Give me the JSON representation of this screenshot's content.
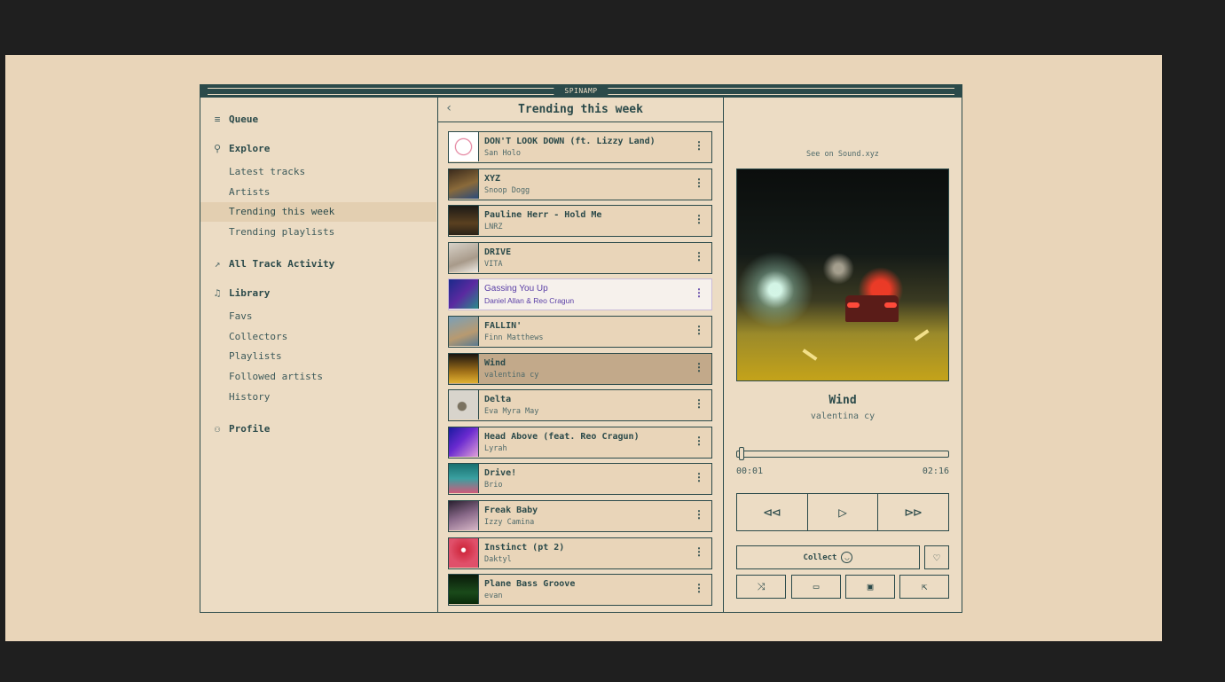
{
  "app": {
    "title": "SPINAMP"
  },
  "colors": {
    "ink": "#2b4a4a",
    "paper": "#ecdcc4",
    "active_row": "#e3cfb1",
    "playing_row": "#c2a98a",
    "hover_text": "#5a3fa6"
  },
  "sidebar": {
    "queue": {
      "icon": "queue-icon",
      "label": "Queue"
    },
    "explore": {
      "icon": "search-icon",
      "label": "Explore",
      "items": [
        "Latest tracks",
        "Artists",
        "Trending this week",
        "Trending playlists"
      ]
    },
    "activity": {
      "icon": "trend-icon",
      "label": "All Track Activity"
    },
    "library": {
      "icon": "music-note-icon",
      "label": "Library",
      "items": [
        "Favs",
        "Collectors",
        "Playlists",
        "Followed artists",
        "History"
      ]
    },
    "profile": {
      "icon": "user-icon",
      "label": "Profile"
    },
    "active_item": "Trending this week"
  },
  "list": {
    "title": "Trending this week",
    "back_icon": "chevron-left-icon",
    "tracks": [
      {
        "title": "DON'T LOOK DOWN (ft. Lizzy Land)",
        "artist": "San Holo"
      },
      {
        "title": "XYZ",
        "artist": "Snoop Dogg"
      },
      {
        "title": "Pauline Herr - Hold Me",
        "artist": "LNRZ"
      },
      {
        "title": "DRIVE",
        "artist": "VITA"
      },
      {
        "title": "Gassing You Up",
        "artist": "Daniel Allan & Reo Cragun",
        "state": "hover"
      },
      {
        "title": "FALLIN'",
        "artist": "Finn Matthews"
      },
      {
        "title": "Wind",
        "artist": "valentina cy",
        "state": "playing"
      },
      {
        "title": "Delta",
        "artist": "Eva Myra May"
      },
      {
        "title": "Head Above (feat. Reo Cragun)",
        "artist": "Lyrah"
      },
      {
        "title": "Drive!",
        "artist": "Brio"
      },
      {
        "title": "Freak Baby",
        "artist": "Izzy Camina"
      },
      {
        "title": "Instinct (pt 2)",
        "artist": "Daktyl"
      },
      {
        "title": "Plane Bass Groove",
        "artist": "evan"
      }
    ]
  },
  "player": {
    "see_on": "See on Sound.xyz",
    "title": "Wind",
    "artist": "valentina cy",
    "elapsed": "00:01",
    "duration": "02:16",
    "progress": 0.01,
    "controls": {
      "prev_icon": "rewind-icon",
      "play_icon": "play-icon",
      "next_icon": "fast-forward-icon"
    },
    "collect_label": "Collect",
    "tool_icons": [
      "shuffle-icon",
      "cast-icon",
      "playlist-add-icon",
      "share-icon"
    ]
  }
}
